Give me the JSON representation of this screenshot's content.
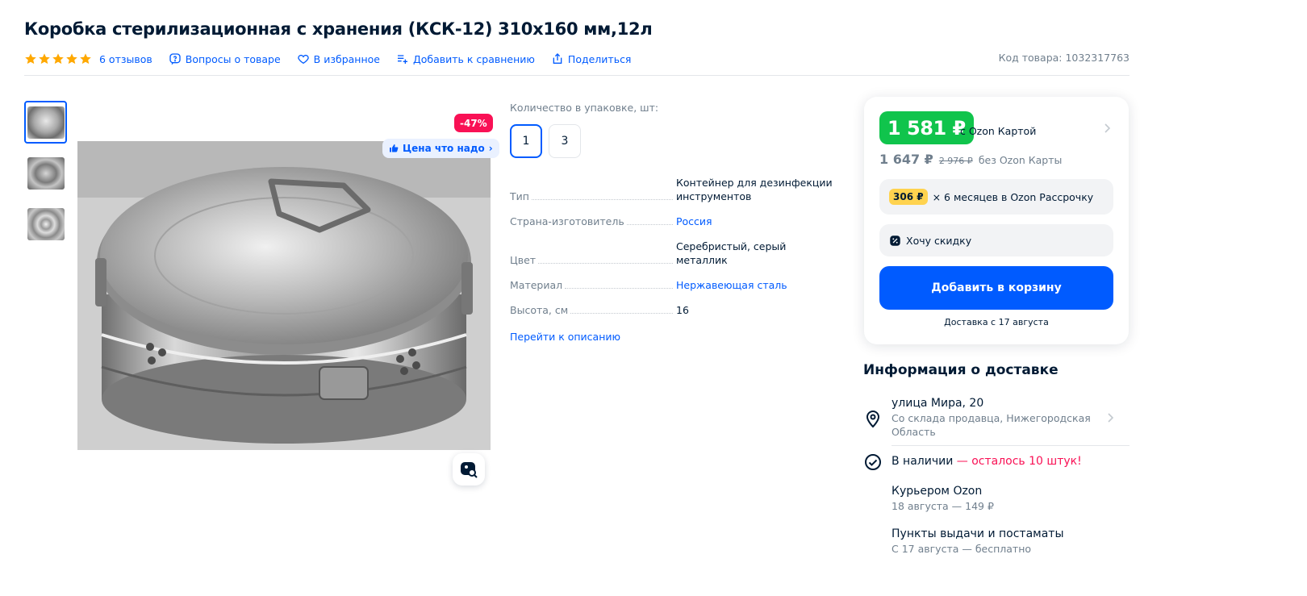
{
  "product": {
    "title": "Коробка стерилизационная с хранения (КСК-12) 310х160 мм,12л",
    "rating_stars": 5,
    "reviews": "6 отзывов",
    "questions": "Вопросы о товаре",
    "favorite": "В избранное",
    "compare": "Добавить к сравнению",
    "share": "Поделиться",
    "sku": "Код товара: 1032317763"
  },
  "gallery": {
    "discount": "-47%",
    "price_tag": "Цена что надо"
  },
  "characteristics": {
    "qty_label": "Количество в упаковке, шт:",
    "qty_options": [
      "1",
      "3"
    ],
    "specs": [
      {
        "key": "Тип",
        "value": "Контейнер для дезинфекции инструментов"
      },
      {
        "key": "Страна-изготовитель",
        "value": "Россия"
      },
      {
        "key": "Цвет",
        "value": "Серебристый, серый металлик"
      },
      {
        "key": "Материал",
        "value": "Нержавеющая сталь"
      },
      {
        "key": "Высота, см",
        "value": "16"
      }
    ],
    "goto_description": "Перейти к описанию"
  },
  "price_card": {
    "card_price": "1 581 ₽",
    "card_price_note": "с Ozon Картой",
    "regular_price": "1 647 ₽",
    "old_price": "2 976 ₽",
    "regular_note": "без Ozon Карты",
    "installment_amount": "306 ₽",
    "installment_text": "× 6 месяцев в Ozon Рассрочку",
    "want_discount": "Хочу скидку",
    "add_to_cart": "Добавить в корзину",
    "delivery_note": "Доставка с 17 августа"
  },
  "delivery": {
    "title": "Информация о доставке",
    "address": "улица Мира, 20",
    "address_sub": "Со склада продавца, Нижегородская Область",
    "stock": "В наличии",
    "stock_warn": " — осталось 10 штук!",
    "options": [
      {
        "title": "Курьером Ozon",
        "sub": "18 августа — 149 ₽"
      },
      {
        "title": "Пункты выдачи и постаматы",
        "sub": "С 17 августа — бесплатно"
      }
    ]
  },
  "colors": {
    "accent": "#005bff",
    "green": "#10c44c",
    "discount": "#f91155",
    "star": "#ffa800",
    "installment": "#ffd34f"
  }
}
